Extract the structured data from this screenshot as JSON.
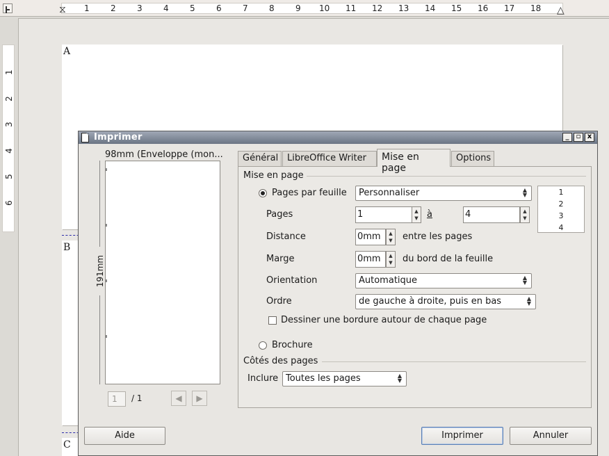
{
  "ruler": {
    "ticks": [
      "1",
      "2",
      "3",
      "4",
      "5",
      "6",
      "7",
      "8",
      "9",
      "10",
      "11",
      "12",
      "13",
      "14",
      "15",
      "16",
      "17",
      "18"
    ],
    "vticks": [
      "1",
      "2",
      "3",
      "4",
      "5",
      "6"
    ]
  },
  "document": {
    "page_letters": [
      "A",
      "B",
      "C"
    ]
  },
  "dialog": {
    "title": "Imprimer",
    "window_buttons": {
      "minimize": "_",
      "maximize": "▫",
      "close": "x"
    },
    "preview": {
      "paper_label": "98mm (Enveloppe (mon...",
      "height_label": "191mm",
      "page_current": "1",
      "page_total": "/ 1"
    },
    "tabs": [
      "Général",
      "LibreOffice Writer",
      "Mise en page",
      "Options"
    ],
    "active_tab": "Mise en page",
    "layout": {
      "section_title": "Mise en page",
      "pages_per_sheet_label": "Pages par feuille",
      "pages_per_sheet_value": "Personnaliser",
      "pages_label": "Pages",
      "pages_from": "1",
      "a_label": "à",
      "pages_to": "4",
      "distance_label": "Distance",
      "distance_value": "0mm",
      "distance_suffix": "entre les pages",
      "margin_label": "Marge",
      "margin_value": "0mm",
      "margin_suffix": "du bord de la feuille",
      "orientation_label": "Orientation",
      "orientation_value": "Automatique",
      "order_label": "Ordre",
      "order_value": "de gauche à droite, puis en bas",
      "border_checkbox_label": "Dessiner une bordure autour de chaque page",
      "brochure_label": "Brochure",
      "mini_preview": [
        "1",
        "2",
        "3",
        "4"
      ]
    },
    "sides": {
      "section_title": "Côtés des pages",
      "include_label": "Inclure",
      "include_value": "Toutes les pages"
    },
    "buttons": {
      "help": "Aide",
      "print": "Imprimer",
      "cancel": "Annuler"
    }
  }
}
